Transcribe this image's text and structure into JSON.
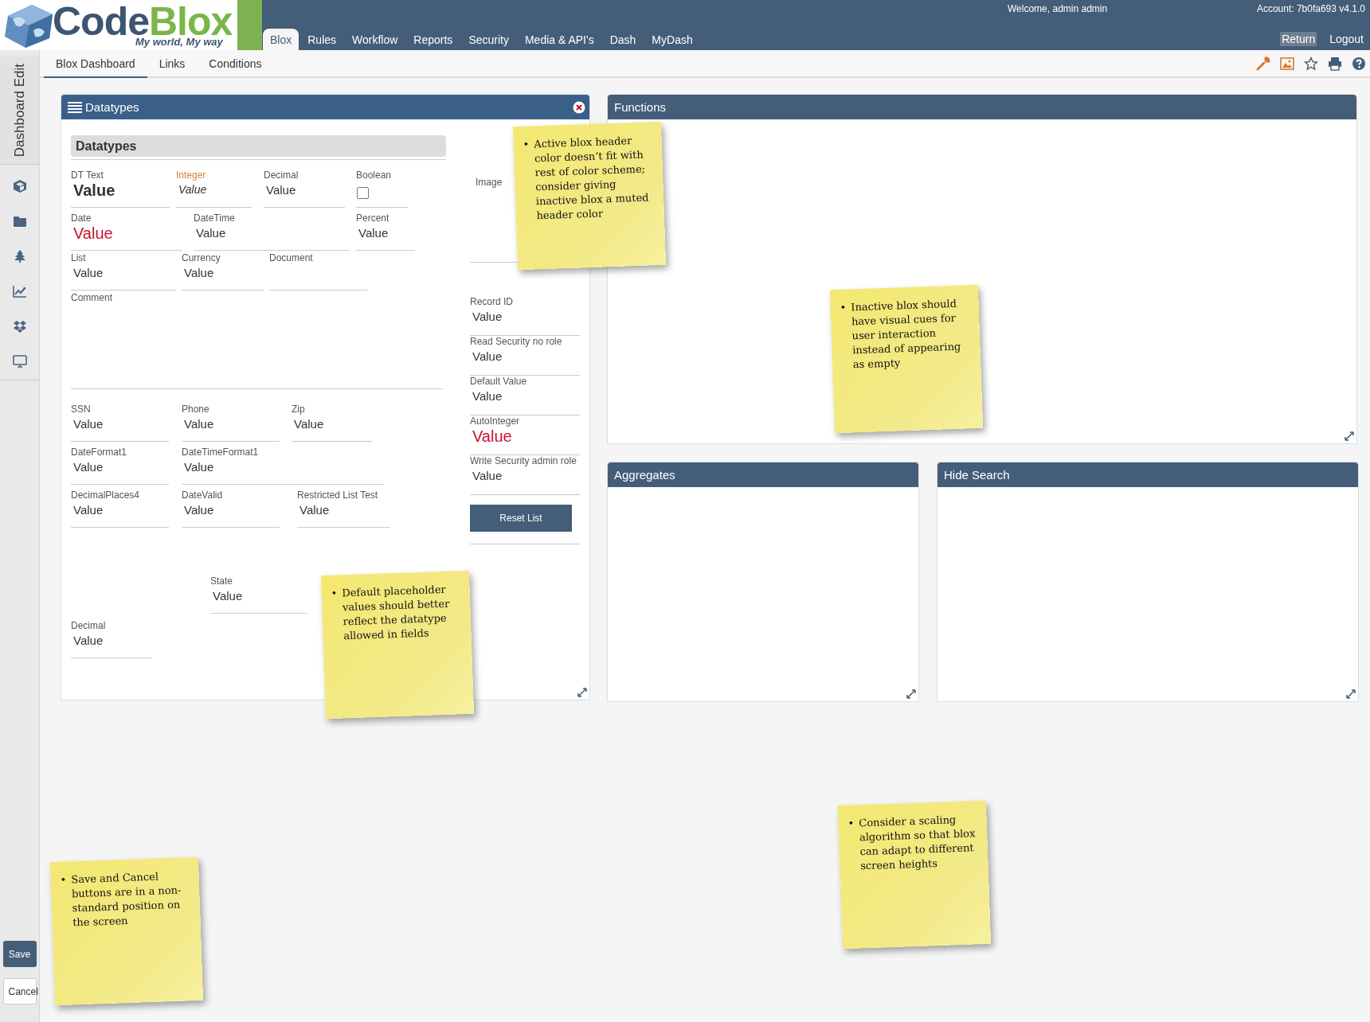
{
  "logo": {
    "word_1": "Code",
    "word_2": "Blox",
    "tagline": "My world, My way"
  },
  "nav": [
    {
      "label": "Blox",
      "selected": true
    },
    {
      "label": "Rules",
      "selected": false
    },
    {
      "label": "Workflow",
      "selected": false
    },
    {
      "label": "Reports",
      "selected": false
    },
    {
      "label": "Security",
      "selected": false
    },
    {
      "label": "Media & API's",
      "selected": false
    },
    {
      "label": "Dash",
      "selected": false
    },
    {
      "label": "MyDash",
      "selected": false
    }
  ],
  "welcome": "Welcome, admin admin",
  "account": "Account: 7b0fa693 v4.1.0",
  "header_links": [
    {
      "label": "Return",
      "selected": true
    },
    {
      "label": "Logout",
      "selected": false
    }
  ],
  "subnav": [
    {
      "label": "Blox Dashboard",
      "selected": true
    },
    {
      "label": "Links",
      "selected": false
    },
    {
      "label": "Conditions",
      "selected": false
    }
  ],
  "sidebar": {
    "tab": "Dashboard Edit",
    "save": "Save",
    "cancel": "Cancel"
  },
  "datatypes_panel": {
    "title": "Datatypes",
    "active": true,
    "section": "Datatypes",
    "rows": [
      [
        {
          "label": "DT Text",
          "value": "Value",
          "kind": "bold"
        },
        {
          "label": "Integer",
          "value": "Value",
          "kind": "italic",
          "accent": true
        },
        {
          "label": "Decimal",
          "value": "Value",
          "kind": "text"
        },
        {
          "label": "Boolean",
          "kind": "checkbox",
          "checked": false
        }
      ],
      [
        {
          "label": "Date",
          "value": "Value",
          "kind": "red"
        },
        {
          "label": "DateTime",
          "value": "Value",
          "kind": "text"
        },
        {
          "label": "Percent",
          "value": "Value",
          "kind": "text"
        }
      ],
      [
        {
          "label": "List",
          "value": "Value",
          "kind": "text"
        },
        {
          "label": "Currency",
          "value": "Value",
          "kind": "text"
        },
        {
          "label": "Document",
          "kind": "empty"
        }
      ],
      [
        {
          "label": "Comment",
          "kind": "textarea"
        }
      ],
      [
        {
          "label": "SSN",
          "value": "Value",
          "kind": "text"
        },
        {
          "label": "Phone",
          "value": "Value",
          "kind": "text"
        },
        {
          "label": "Zip",
          "value": "Value",
          "kind": "text"
        }
      ],
      [
        {
          "label": "DateFormat1",
          "value": "Value",
          "kind": "text"
        },
        {
          "label": "DateTimeFormat1",
          "value": "Value",
          "kind": "text"
        }
      ],
      [
        {
          "label": "DecimalPlaces4",
          "value": "Value",
          "kind": "text"
        },
        {
          "label": "DateValid",
          "value": "Value",
          "kind": "text"
        },
        {
          "label": "Restricted List Test",
          "value": "Value",
          "kind": "text"
        }
      ],
      [
        {
          "label": "State",
          "value": "Value",
          "kind": "text"
        }
      ],
      [
        {
          "label": "Decimal",
          "value": "Value",
          "kind": "text"
        }
      ]
    ],
    "image_label": "Image",
    "side_fields": [
      {
        "label": "Record ID",
        "value": "Value",
        "kind": "text"
      },
      {
        "label": "Read Security no role",
        "value": "Value",
        "kind": "text"
      },
      {
        "label": "Default Value",
        "value": "Value",
        "kind": "text"
      },
      {
        "label": "AutoInteger",
        "value": "Value",
        "kind": "red"
      },
      {
        "label": "Write Security admin role",
        "value": "Value",
        "kind": "text"
      }
    ],
    "reset_button": "Reset List"
  },
  "panels": [
    {
      "title": "Functions",
      "active": false
    },
    {
      "title": "Aggregates",
      "active": false
    },
    {
      "title": "Hide Search",
      "active": false
    }
  ],
  "notes": [
    {
      "marker": "•",
      "text": "Active blox header color doesn’t fit with rest of color scheme; consider giving inactive blox a muted header color"
    },
    {
      "marker": "•",
      "text": "Inactive blox should have visual cues for user interaction instead of appearing as empty"
    },
    {
      "marker": "•",
      "text": "Default placeholder values should better reflect the datatype allowed in fields"
    },
    {
      "marker": "•",
      "text": "Consider a scaling algorithm so that blox can adapt to different screen heights"
    },
    {
      "marker": "•",
      "text": "Save and Cancel buttons are in a non-standard position on the screen"
    }
  ]
}
